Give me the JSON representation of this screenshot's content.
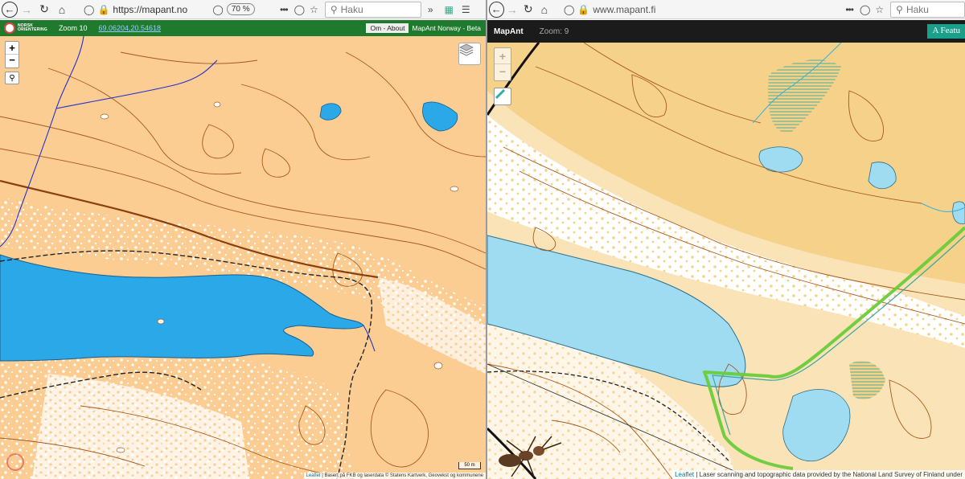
{
  "left": {
    "toolbar": {
      "url": "https://mapant.no",
      "zoom": "70 %",
      "search_placeholder": "Haku",
      "more": "•••"
    },
    "mapbar": {
      "logo_line1": "NORSK",
      "logo_line2": "ORIENTERING",
      "zoom_label": "Zoom 10",
      "coords": "69.06204,20.54618",
      "about_button": "Om - About",
      "title": "MapAnt Norway - Beta"
    },
    "map": {
      "zoom_in": "+",
      "zoom_out": "−",
      "scale": "50 m",
      "attribution_leaflet": "Leaflet",
      "attribution_text": " | Basert på FKB og laserdata © Statens Kartverk, Geovekst og kommunene"
    }
  },
  "right": {
    "toolbar": {
      "url": "www.mapant.fi",
      "search_placeholder": "Haku",
      "more": "•••"
    },
    "mapbar": {
      "title": "MapAnt",
      "zoom_label": "Zoom: 9",
      "feature_button": "A Featu"
    },
    "map": {
      "zoom_in": "+",
      "zoom_out": "−",
      "attribution_leaflet": "Leaflet",
      "attribution_text": " | Laser scanning and topographic data provided by the National Land Survey of Finland under"
    }
  },
  "colors": {
    "land": "#fbcd92",
    "open_white": "#ffffff",
    "water": "#2aa8e8",
    "water_fi": "#9fdcf2",
    "contour": "#a8581a",
    "stream": "#2030d0",
    "power_line": "#6acc3a"
  }
}
